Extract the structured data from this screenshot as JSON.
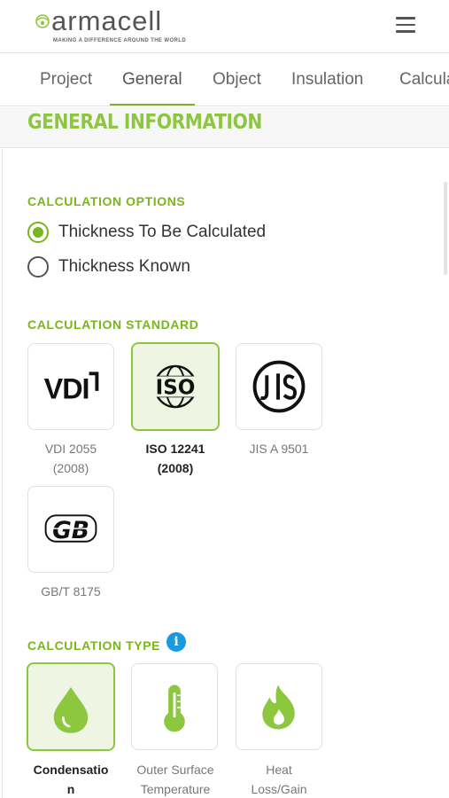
{
  "brand": {
    "name": "armacell",
    "tagline": "MAKING A DIFFERENCE AROUND THE WORLD",
    "accent": "#8dc63f",
    "info_color": "#1a9be0"
  },
  "nav": {
    "tabs": [
      {
        "label": "Project"
      },
      {
        "label": "General"
      },
      {
        "label": "Object"
      },
      {
        "label": "Insulation"
      },
      {
        "label": "Calcula"
      }
    ],
    "active": "General"
  },
  "section": {
    "title": "GENERAL INFORMATION"
  },
  "calc_options": {
    "label": "CALCULATION OPTIONS",
    "options": [
      {
        "label": "Thickness To Be Calculated",
        "checked": true
      },
      {
        "label": "Thickness Known",
        "checked": false
      }
    ]
  },
  "calc_standard": {
    "label": "CALCULATION STANDARD",
    "items": [
      {
        "logo": "VDI",
        "line1": "VDI 2055",
        "line2": "(2008)",
        "selected": false
      },
      {
        "logo": "ISO",
        "line1": "ISO 12241",
        "line2": "(2008)",
        "selected": true
      },
      {
        "logo": "JIS",
        "line1": "JIS A 9501",
        "line2": "",
        "selected": false
      },
      {
        "logo": "GB",
        "line1": "GB/T 8175",
        "line2": "",
        "selected": false
      }
    ]
  },
  "calc_type": {
    "label": "CALCULATION TYPE",
    "info_symbol": "i",
    "items": [
      {
        "icon": "droplet-icon",
        "line1": "Condensatio",
        "line2": "n",
        "selected": true
      },
      {
        "icon": "thermometer-icon",
        "line1": "Outer Surface",
        "line2": "Temperature",
        "selected": false
      },
      {
        "icon": "flame-icon",
        "line1": "Heat",
        "line2": "Loss/Gain",
        "selected": false
      }
    ]
  }
}
